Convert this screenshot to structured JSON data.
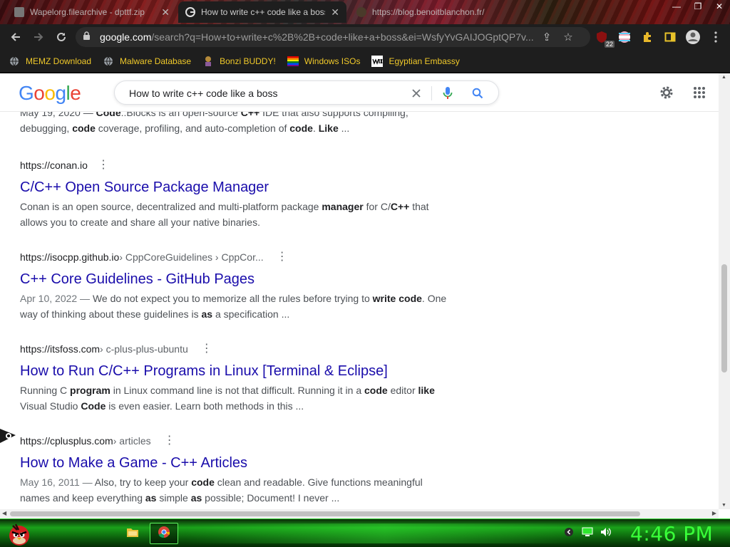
{
  "browser": {
    "tabs": [
      {
        "title": "Wapelorg.filearchive - dpttf.zip",
        "active": false
      },
      {
        "title": "How to write c++ code like a boss",
        "active": true
      },
      {
        "title": "https://blog.benoitblanchon.fr/",
        "active": false
      }
    ],
    "address": {
      "host": "google.com",
      "path": "/search?q=How+to+write+c%2B%2B+code+like+a+boss&ei=WsfyYvGAIJOGptQP7v..."
    },
    "ext_badge": "22",
    "bookmarks": [
      {
        "label": "MEMZ Download",
        "icon": "globe-icon"
      },
      {
        "label": "Malware Database",
        "icon": "globe-icon"
      },
      {
        "label": "Bonzi BUDDY!",
        "icon": "bonzi-icon"
      },
      {
        "label": "Windows ISOs",
        "icon": "windows-flag-icon"
      },
      {
        "label": "Egyptian Embassy",
        "icon": "wix-icon"
      }
    ]
  },
  "google": {
    "logo": "Google",
    "query": "How to write c++ code like a boss"
  },
  "partial_result": {
    "date": "May 19, 2020",
    "snippet_html": "May 19, 2020 — <b>Code</b>::Blocks is an open-source <b>C++</b> IDE that also supports compiling, debugging, <b>code</b> coverage, profiling, and auto-completion of <b>code</b>. <b>Like</b> ..."
  },
  "results": [
    {
      "url": "https://conan.io",
      "crumb": "",
      "title": "C/C++ Open Source Package Manager",
      "snippet_html": "Conan is an open source, decentralized and multi-platform package <b>manager</b> for C/<b>C++</b> that allows you to create and share all your native binaries."
    },
    {
      "url": "https://isocpp.github.io",
      "crumb": " › CppCoreGuidelines › CppCor...",
      "title": "C++ Core Guidelines - GitHub Pages",
      "snippet_html": "<span class='date'>Apr 10, 2022 —</span> We do not expect you to memorize all the rules before trying to <b>write code</b>. One way of thinking about these guidelines is <b>as</b> a specification ..."
    },
    {
      "url": "https://itsfoss.com",
      "crumb": " › c-plus-plus-ubuntu",
      "title": "How to Run C/C++ Programs in Linux [Terminal & Eclipse]",
      "snippet_html": "Running C <b>program</b> in Linux command line is not that difficult. Running it in a <b>code</b> editor <b>like</b> Visual Studio <b>Code</b> is even easier. Learn both methods in this ..."
    },
    {
      "url": "https://cplusplus.com",
      "crumb": " › articles",
      "title": "How to Make a Game - C++ Articles",
      "snippet_html": "<span class='date'>May 16, 2011 —</span> Also, try to keep your <b>code</b> clean and readable. Give functions meaningful names and keep everything <b>as</b> simple <b>as</b> possible; Document! I never ..."
    }
  ],
  "taskbar": {
    "clock": "4:46 PM"
  },
  "colors": {
    "link": "#1a0dab",
    "bookmark_text": "#f0c92a",
    "clock": "#39ff39"
  }
}
